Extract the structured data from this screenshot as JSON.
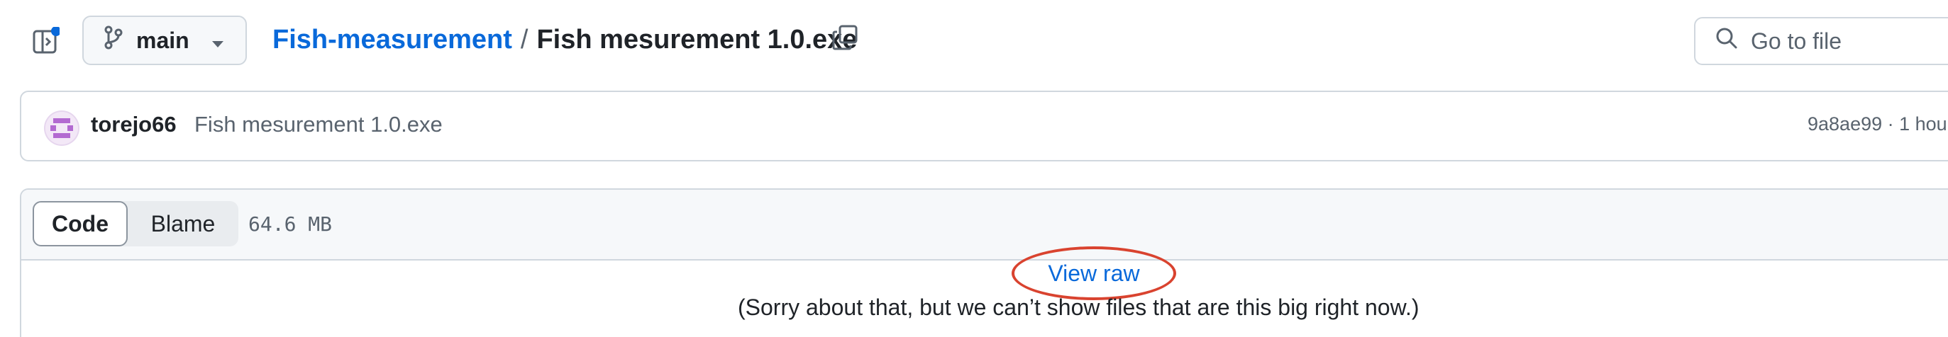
{
  "header": {
    "branch": "main",
    "repo": "Fish-measurement",
    "separator": "/",
    "file": "Fish mesurement 1.0.exe",
    "goto_file_placeholder": "Go to file"
  },
  "commit": {
    "author": "torejo66",
    "message": "Fish mesurement 1.0.exe",
    "meta": "9a8ae99 · 1 hou"
  },
  "file_view": {
    "tabs": [
      "Code",
      "Blame"
    ],
    "active_tab": "Code",
    "size": "64.6 MB",
    "view_raw": "View raw",
    "notice": "(Sorry about that, but we can’t show files that are this big right now.)"
  },
  "icons": {
    "sidebar": "sidebar-expand-icon",
    "branch": "git-branch-icon",
    "caret": "triangle-down-icon",
    "copy": "copy-icon",
    "search": "search-icon"
  },
  "colors": {
    "link": "#0969da",
    "highlight": "#d9432f",
    "notification_dot": "#0969da"
  }
}
